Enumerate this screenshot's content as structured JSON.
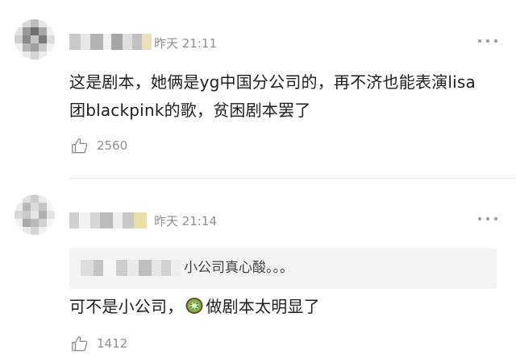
{
  "comments": [
    {
      "time": "昨天 21:11",
      "text": "这是剧本，她俩是yg中国分公司的，再不济也能表演lisa团blackpink的歌，贫困剧本罢了",
      "likes": "2560",
      "avatar_icon": "pixelated-avatar",
      "more_icon": "more-dots-icon",
      "like_icon": "thumbs-up-icon"
    },
    {
      "time": "昨天 21:14",
      "quote_text": "小公司真心酸。。。",
      "text_before": "可不是小公司，",
      "text_after": "做剧本太明显了",
      "emoji_icon": "kiwi-emoji-icon",
      "likes": "1412",
      "avatar_icon": "pixelated-avatar",
      "more_icon": "more-dots-icon",
      "like_icon": "thumbs-up-icon"
    }
  ],
  "colors": {
    "secondary_text": "#8e8e8e",
    "body_text": "#1f1f1f",
    "quote_background": "#f3f3f3",
    "divider": "#e4e4e4"
  }
}
